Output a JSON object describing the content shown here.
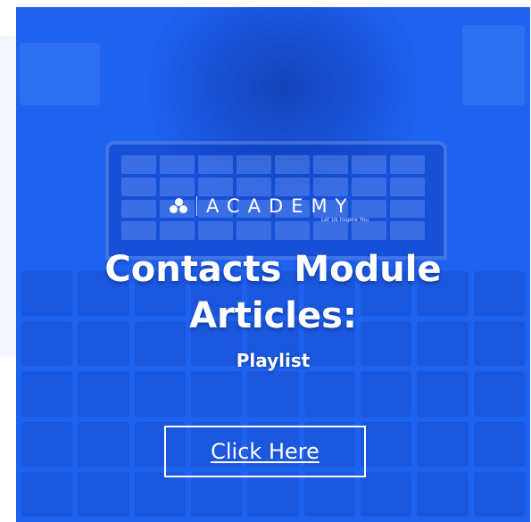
{
  "banner": {
    "brand": {
      "name": "ACADEMY",
      "tagline": "Let Us Inspire You",
      "icon": "three-dots-logo-icon"
    },
    "title_line1": "Contacts Module",
    "title_line2": "Articles:",
    "subtitle": "Playlist",
    "cta_label": "Click Here",
    "colors": {
      "background": "#1e62f0",
      "text": "#ffffff"
    }
  }
}
